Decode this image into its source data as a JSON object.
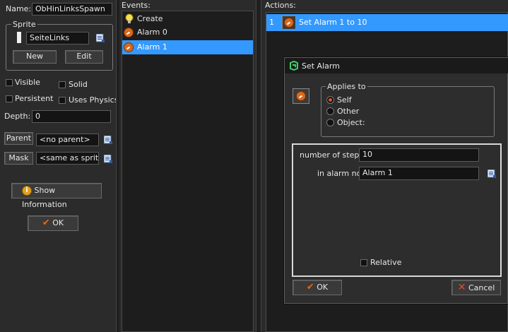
{
  "object": {
    "name_label": "Name:",
    "name_value": "ObHinLinksSpawn",
    "sprite_group_label": "Sprite",
    "sprite_value": "SeiteLinks",
    "new_label": "New",
    "edit_label": "Edit",
    "visible_label": "Visible",
    "solid_label": "Solid",
    "persistent_label": "Persistent",
    "uses_physics_label": "Uses Physics",
    "depth_label": "Depth:",
    "depth_value": "0",
    "parent_label": "Parent",
    "parent_value": "<no parent>",
    "mask_label": "Mask",
    "mask_value": "<same as sprite>",
    "show_info_label": "Show Information",
    "ok_label": "OK"
  },
  "events": {
    "header": "Events:",
    "items": [
      {
        "label": "Create",
        "icon": "lightbulb-icon"
      },
      {
        "label": "Alarm 0",
        "icon": "alarm-clock-icon"
      },
      {
        "label": "Alarm 1",
        "icon": "alarm-clock-icon",
        "selected": true
      }
    ]
  },
  "actions": {
    "header": "Actions:",
    "items": [
      {
        "index": "1",
        "label": "Set Alarm 1 to 10",
        "icon": "alarm-clock-icon",
        "selected": true
      }
    ]
  },
  "dialog": {
    "title": "Set Alarm",
    "applies_to_label": "Applies to",
    "options": [
      "Self",
      "Other",
      "Object:"
    ],
    "selected_option": "Self",
    "steps_label": "number of steps:",
    "steps_value": "10",
    "alarm_label": "in alarm no:",
    "alarm_value": "Alarm 1",
    "relative_label": "Relative",
    "ok_label": "OK",
    "cancel_label": "Cancel"
  },
  "colors": {
    "selection": "#3399ff",
    "background": "#2b2b2b",
    "alarm_orange": "#d86a1c"
  }
}
